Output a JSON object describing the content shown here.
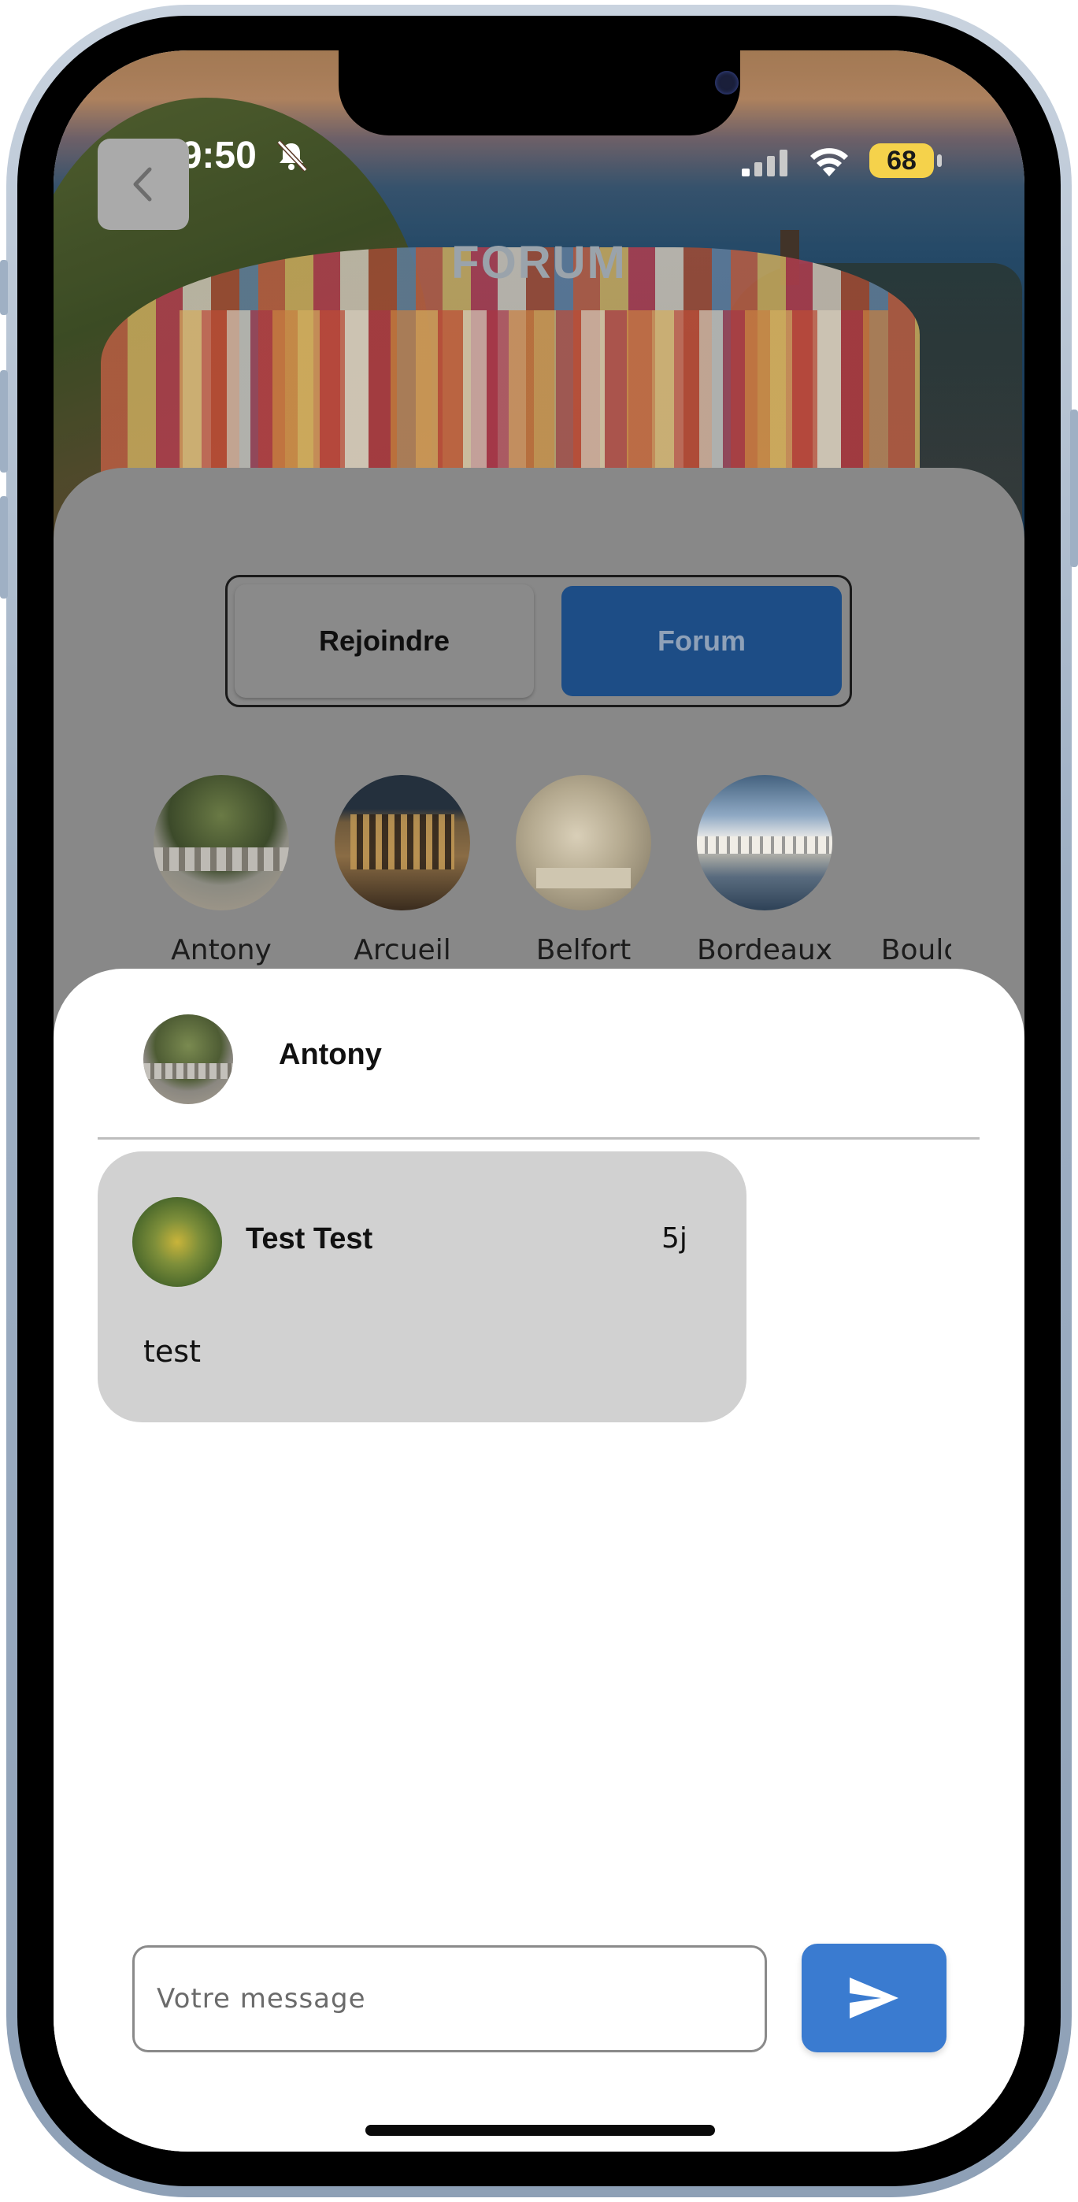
{
  "status_bar": {
    "time": "19:50",
    "battery": "68"
  },
  "header": {
    "title": "FORUM"
  },
  "segmented": {
    "left_label": "Rejoindre",
    "right_label": "Forum",
    "selected": "Forum"
  },
  "cities": [
    {
      "name": "Antony"
    },
    {
      "name": "Arcueil"
    },
    {
      "name": "Belfort"
    },
    {
      "name": "Bordeaux"
    },
    {
      "name": "Boulog"
    }
  ],
  "forum": {
    "name": "Antony"
  },
  "messages": [
    {
      "author": "Test Test",
      "time": "5j",
      "text": "test"
    }
  ],
  "composer": {
    "placeholder": "Votre message"
  },
  "icons": {
    "back": "chevron-left-icon",
    "bell_off": "bell-slash-icon",
    "send": "paper-plane-icon",
    "signal": "cellular-signal-icon",
    "wifi": "wifi-icon",
    "battery": "battery-icon"
  },
  "colors": {
    "accent": "#3a7bd0",
    "selected_tab": "#1d4d86",
    "message_bubble": "#d1d1d1",
    "battery": "#f5d24b"
  }
}
